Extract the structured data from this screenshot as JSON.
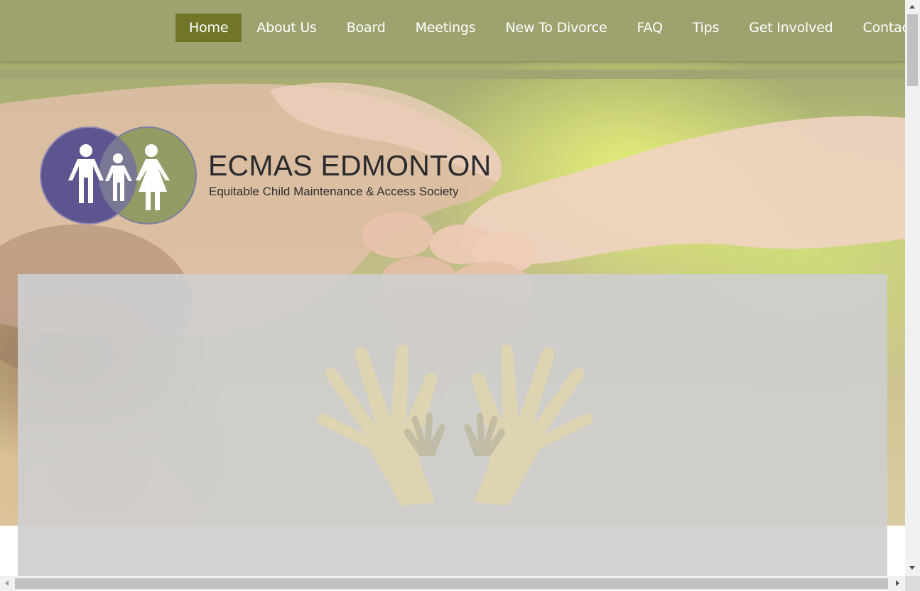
{
  "nav": {
    "items": [
      {
        "label": "Home",
        "active": true
      },
      {
        "label": "About Us",
        "active": false
      },
      {
        "label": "Board",
        "active": false
      },
      {
        "label": "Meetings",
        "active": false
      },
      {
        "label": "New To Divorce",
        "active": false
      },
      {
        "label": "FAQ",
        "active": false
      },
      {
        "label": "Tips",
        "active": false
      },
      {
        "label": "Get Involved",
        "active": false
      },
      {
        "label": "Contact Us",
        "active": false
      }
    ]
  },
  "brand": {
    "title": "ECMAS EDMONTON",
    "subtitle": "Equitable Child Maintenance & Access Society",
    "logo_icon": "family-circles-icon"
  },
  "hero": {
    "image_icon": "holding-hands-photo"
  },
  "panel": {
    "icon": "adult-child-hands-icon"
  },
  "colors": {
    "nav_bg": "#9ea26f",
    "nav_active": "#707528",
    "logo_purple": "#5d5590",
    "logo_green": "#8f9a62",
    "panel_bg": "#cecece",
    "hands_tint": "#ded4b0"
  }
}
